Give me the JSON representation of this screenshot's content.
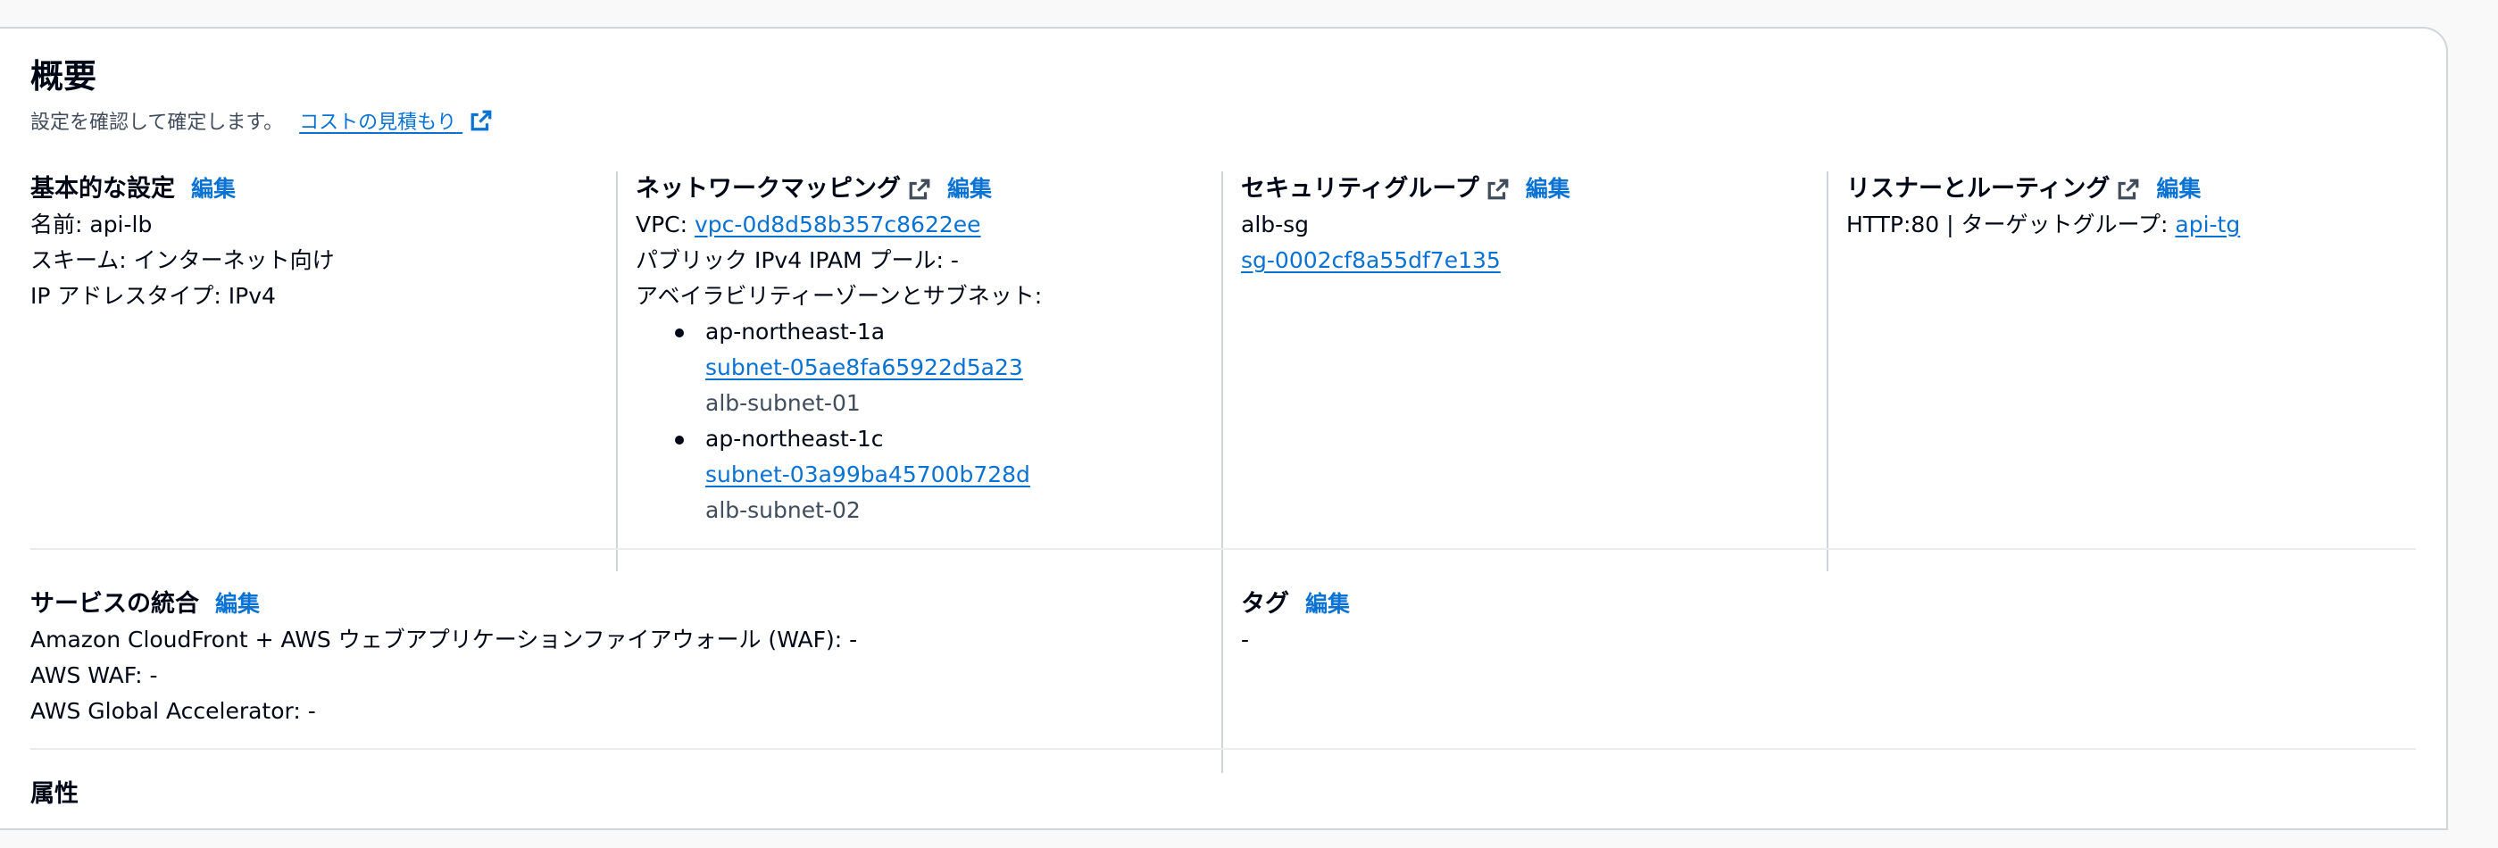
{
  "header": {
    "title": "概要",
    "description": "設定を確認して確定します。",
    "cost_link": "コストの見積もり"
  },
  "edit_label": "編集",
  "basic": {
    "title": "基本的な設定",
    "name": "名前: api-lb",
    "scheme": "スキーム: インターネット向け",
    "ip_type": "IP アドレスタイプ: IPv4"
  },
  "network": {
    "title": "ネットワークマッピング",
    "vpc_label": "VPC: ",
    "vpc_id": "vpc-0d8d58b357c8622ee",
    "ipam": "パブリック IPv4 IPAM プール: -",
    "az_header": "アベイラビリティーゾーンとサブネット:",
    "zones": [
      {
        "az": "ap-northeast-1a",
        "subnet_id": "subnet-05ae8fa65922d5a23",
        "subnet_name": "alb-subnet-01"
      },
      {
        "az": "ap-northeast-1c",
        "subnet_id": "subnet-03a99ba45700b728d",
        "subnet_name": "alb-subnet-02"
      }
    ]
  },
  "security": {
    "title": "セキュリティグループ",
    "group_name": "alb-sg",
    "group_id": "sg-0002cf8a55df7e135"
  },
  "listeners": {
    "title": "リスナーとルーティング",
    "prefix": "HTTP:80 | ターゲットグループ: ",
    "target_group": "api-tg"
  },
  "services": {
    "title": "サービスの統合",
    "cloudfront": "Amazon CloudFront + AWS ウェブアプリケーションファイアウォール (WAF): -",
    "waf": "AWS WAF: -",
    "global_accelerator": "AWS Global Accelerator: -"
  },
  "tags": {
    "title": "タグ",
    "value": "-"
  },
  "attributes": {
    "title": "属性"
  },
  "colors": {
    "link": "#0972d3",
    "text": "#000716",
    "divider": "#d1d5db"
  }
}
